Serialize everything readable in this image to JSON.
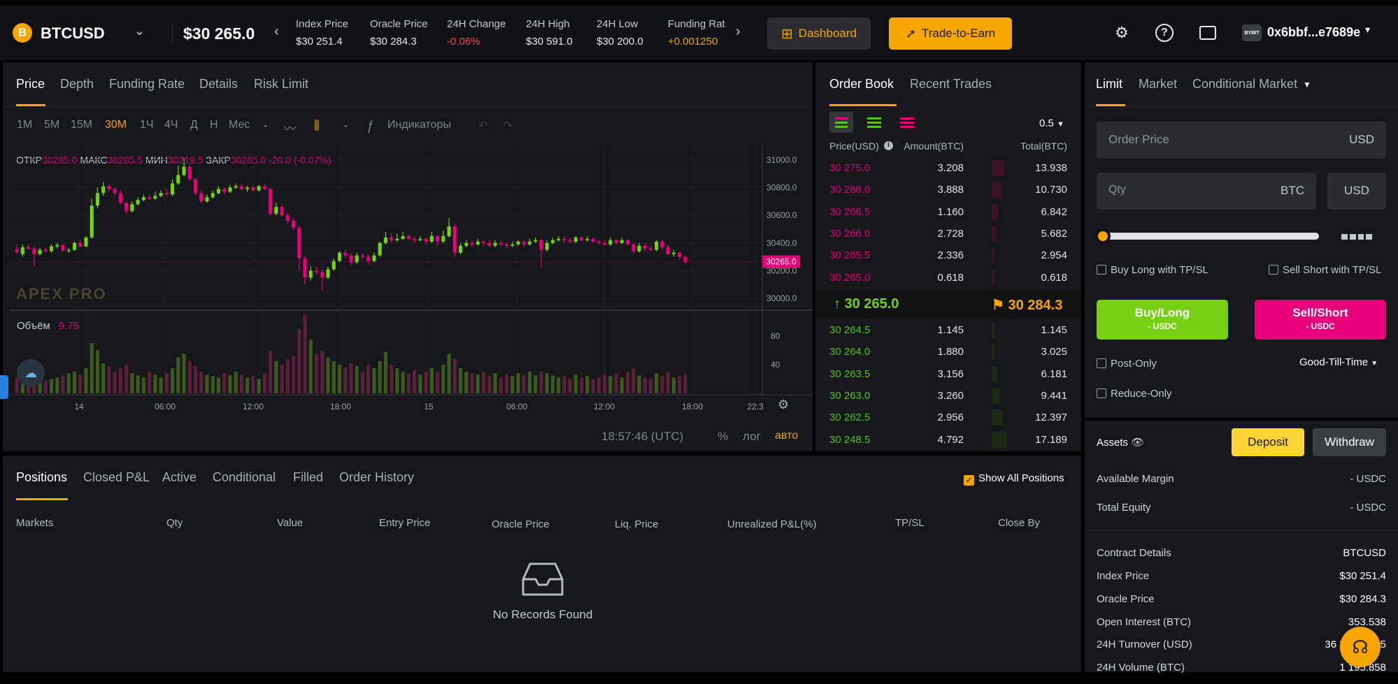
{
  "header": {
    "coin_glyph": "B",
    "symbol": "BTCUSD",
    "last_price": "$30 265.0",
    "stats": [
      {
        "label": "Index Price",
        "value": "$30 251.4",
        "color": "#e6e8ea"
      },
      {
        "label": "Oracle Price",
        "value": "$30 284.3",
        "color": "#e6e8ea"
      },
      {
        "label": "24H Change",
        "value": "-0.06%",
        "color": "#f6465d"
      },
      {
        "label": "24H High",
        "value": "$30 591.0",
        "color": "#e6e8ea"
      },
      {
        "label": "24H Low",
        "value": "$30 200.0",
        "color": "#e6e8ea"
      },
      {
        "label": "Funding Rat",
        "value": "+0.001250",
        "color": "#f7a600"
      }
    ],
    "dashboard_label": "Dashboard",
    "trade_to_earn_label": "Trade-to-Earn",
    "wallet_badge": "BYBIT",
    "wallet_address": "0x6bbf...e7689e"
  },
  "chart_tabs": [
    "Price",
    "Depth",
    "Funding Rate",
    "Details",
    "Risk Limit"
  ],
  "chart_toolbar": {
    "intervals": [
      "1M",
      "5M",
      "15M",
      "30M",
      "1Ч",
      "4Ч",
      "Д",
      "Н",
      "Мес"
    ],
    "active_interval": "30M",
    "indicators_label": "Индикаторы"
  },
  "ohlc": {
    "open_label": "ОТКР",
    "open": "30285.0",
    "high_label": "МАКС",
    "high": "30285.5",
    "low_label": "МИН",
    "low": "30219.5",
    "close_label": "ЗАКР",
    "close": "30265.0",
    "change": "-20.0 (-0.07%)"
  },
  "volume": {
    "label": "Объём",
    "value": "9.75"
  },
  "watermark": "APEX PRO",
  "chart_footer": {
    "time": "18:57:46 (UTC)",
    "pct": "%",
    "log": "лог",
    "auto": "авто"
  },
  "chart_data": {
    "type": "candlestick",
    "y_ticks": [
      31000,
      30800,
      30600,
      30400,
      30200,
      30000
    ],
    "ylim": [
      29935,
      31120
    ],
    "last_price_label": "30265.0",
    "x_ticks": [
      "14",
      "06:00",
      "12:00",
      "18:00",
      "15",
      "06:00",
      "12:00",
      "18:00",
      "22:3"
    ],
    "volume_ticks": [
      80,
      40
    ],
    "volume_max": 110,
    "candles": [
      [
        30355,
        30335,
        30390,
        30320
      ],
      [
        30320,
        30370,
        30390,
        30300
      ],
      [
        30370,
        30360,
        30390,
        30350
      ],
      [
        30360,
        30320,
        30375,
        30230
      ],
      [
        30320,
        30350,
        30365,
        30310
      ],
      [
        30350,
        30340,
        30370,
        30330
      ],
      [
        30340,
        30375,
        30390,
        30330
      ],
      [
        30375,
        30385,
        30400,
        30360
      ],
      [
        30385,
        30345,
        30395,
        30335
      ],
      [
        30345,
        30350,
        30365,
        30330
      ],
      [
        30350,
        30400,
        30410,
        30345
      ],
      [
        30400,
        30375,
        30420,
        30365
      ],
      [
        30375,
        30440,
        30450,
        30370
      ],
      [
        30440,
        30670,
        30720,
        30430
      ],
      [
        30670,
        30760,
        30800,
        30650
      ],
      [
        30760,
        30810,
        30840,
        30740
      ],
      [
        30810,
        30790,
        30830,
        30770
      ],
      [
        30790,
        30760,
        30800,
        30740
      ],
      [
        30760,
        30690,
        30780,
        30680
      ],
      [
        30690,
        30630,
        30700,
        30610
      ],
      [
        30630,
        30680,
        30700,
        30620
      ],
      [
        30680,
        30710,
        30730,
        30670
      ],
      [
        30710,
        30730,
        30750,
        30700
      ],
      [
        30730,
        30720,
        30750,
        30710
      ],
      [
        30720,
        30740,
        30770,
        30710
      ],
      [
        30740,
        30760,
        30780,
        30730
      ],
      [
        30760,
        30750,
        30790,
        30740
      ],
      [
        30750,
        30830,
        30860,
        30740
      ],
      [
        30830,
        30890,
        30960,
        30820
      ],
      [
        30890,
        30950,
        31010,
        30880
      ],
      [
        30950,
        30860,
        30970,
        30850
      ],
      [
        30860,
        30760,
        30870,
        30740
      ],
      [
        30760,
        30700,
        30780,
        30690
      ],
      [
        30700,
        30730,
        30750,
        30690
      ],
      [
        30730,
        30760,
        30780,
        30720
      ],
      [
        30760,
        30790,
        30810,
        30750
      ],
      [
        30790,
        30770,
        30800,
        30750
      ],
      [
        30770,
        30800,
        30820,
        30760
      ],
      [
        30800,
        30810,
        30830,
        30790
      ],
      [
        30810,
        30790,
        30830,
        30780
      ],
      [
        30790,
        30800,
        30810,
        30770
      ],
      [
        30800,
        30780,
        30820,
        30770
      ],
      [
        30780,
        30810,
        30820,
        30770
      ],
      [
        30810,
        30790,
        30830,
        30780
      ],
      [
        30790,
        30610,
        30800,
        30600
      ],
      [
        30610,
        30660,
        30690,
        30600
      ],
      [
        30660,
        30600,
        30680,
        30590
      ],
      [
        30600,
        30560,
        30620,
        30540
      ],
      [
        30560,
        30510,
        30580,
        30490
      ],
      [
        30510,
        30290,
        30530,
        30200
      ],
      [
        30290,
        30150,
        30310,
        30100
      ],
      [
        30150,
        30200,
        30230,
        30130
      ],
      [
        30200,
        30190,
        30230,
        30170
      ],
      [
        30190,
        30150,
        30210,
        30060
      ],
      [
        30150,
        30210,
        30230,
        30140
      ],
      [
        30210,
        30270,
        30290,
        30200
      ],
      [
        30270,
        30330,
        30340,
        30260
      ],
      [
        30330,
        30310,
        30350,
        30290
      ],
      [
        30310,
        30260,
        30330,
        30240
      ],
      [
        30260,
        30310,
        30330,
        30250
      ],
      [
        30310,
        30300,
        30330,
        30280
      ],
      [
        30300,
        30270,
        30320,
        30240
      ],
      [
        30270,
        30310,
        30330,
        30260
      ],
      [
        30310,
        30400,
        30410,
        30300
      ],
      [
        30400,
        30440,
        30480,
        30390
      ],
      [
        30440,
        30420,
        30470,
        30400
      ],
      [
        30420,
        30430,
        30470,
        30410
      ],
      [
        30430,
        30450,
        30480,
        30420
      ],
      [
        30450,
        30430,
        30460,
        30420
      ],
      [
        30430,
        30420,
        30450,
        30400
      ],
      [
        30420,
        30430,
        30450,
        30410
      ],
      [
        30430,
        30410,
        30440,
        30390
      ],
      [
        30410,
        30450,
        30480,
        30400
      ],
      [
        30450,
        30410,
        30460,
        30380
      ],
      [
        30410,
        30450,
        30490,
        30400
      ],
      [
        30450,
        30520,
        30580,
        30440
      ],
      [
        30520,
        30330,
        30540,
        30300
      ],
      [
        30330,
        30380,
        30400,
        30320
      ],
      [
        30380,
        30400,
        30420,
        30370
      ],
      [
        30400,
        30390,
        30420,
        30370
      ],
      [
        30390,
        30410,
        30430,
        30380
      ],
      [
        30410,
        30400,
        30420,
        30380
      ],
      [
        30400,
        30380,
        30420,
        30370
      ],
      [
        30380,
        30400,
        30420,
        30370
      ],
      [
        30400,
        30390,
        30420,
        30380
      ],
      [
        30390,
        30380,
        30410,
        30360
      ],
      [
        30380,
        30390,
        30410,
        30370
      ],
      [
        30390,
        30410,
        30420,
        30380
      ],
      [
        30410,
        30390,
        30420,
        30370
      ],
      [
        30390,
        30410,
        30430,
        30380
      ],
      [
        30410,
        30420,
        30440,
        30400
      ],
      [
        30420,
        30350,
        30430,
        30220
      ],
      [
        30350,
        30400,
        30420,
        30340
      ],
      [
        30400,
        30420,
        30440,
        30390
      ],
      [
        30420,
        30430,
        30450,
        30410
      ],
      [
        30430,
        30420,
        30450,
        30400
      ],
      [
        30420,
        30410,
        30440,
        30400
      ],
      [
        30410,
        30440,
        30450,
        30400
      ],
      [
        30440,
        30420,
        30450,
        30410
      ],
      [
        30420,
        30430,
        30450,
        30410
      ],
      [
        30430,
        30410,
        30440,
        30400
      ],
      [
        30410,
        30400,
        30420,
        30390
      ],
      [
        30400,
        30390,
        30420,
        30380
      ],
      [
        30390,
        30420,
        30440,
        30380
      ],
      [
        30420,
        30400,
        30430,
        30390
      ],
      [
        30400,
        30420,
        30440,
        30390
      ],
      [
        30420,
        30390,
        30430,
        30380
      ],
      [
        30390,
        30340,
        30400,
        30320
      ],
      [
        30340,
        30380,
        30400,
        30330
      ],
      [
        30380,
        30360,
        30400,
        30340
      ],
      [
        30360,
        30350,
        30380,
        30340
      ],
      [
        30350,
        30410,
        30420,
        30340
      ],
      [
        30410,
        30370,
        30420,
        30350
      ],
      [
        30370,
        30320,
        30390,
        30310
      ],
      [
        30320,
        30330,
        30350,
        30300
      ],
      [
        30330,
        30300,
        30340,
        30280
      ],
      [
        30300,
        30265,
        30310,
        30250
      ]
    ],
    "volumes": [
      22,
      18,
      20,
      30,
      25,
      18,
      20,
      22,
      25,
      28,
      30,
      26,
      35,
      70,
      60,
      42,
      38,
      30,
      35,
      40,
      28,
      25,
      22,
      30,
      26,
      22,
      28,
      35,
      50,
      55,
      45,
      38,
      30,
      26,
      24,
      22,
      28,
      25,
      30,
      26,
      22,
      24,
      20,
      28,
      60,
      45,
      40,
      48,
      52,
      90,
      110,
      75,
      55,
      60,
      50,
      45,
      40,
      36,
      42,
      38,
      30,
      40,
      35,
      45,
      58,
      40,
      35,
      30,
      28,
      32,
      26,
      30,
      35,
      30,
      40,
      55,
      48,
      35,
      30,
      28,
      26,
      30,
      24,
      28,
      22,
      26,
      24,
      28,
      26,
      30,
      25,
      30,
      28,
      25,
      22,
      24,
      20,
      26,
      22,
      24,
      20,
      22,
      26,
      24,
      28,
      22,
      30,
      35,
      25,
      22,
      20,
      28,
      24,
      30,
      22,
      24,
      26
    ]
  },
  "orderbook": {
    "tabs": [
      "Order Book",
      "Recent Trades"
    ],
    "precision": "0.5",
    "columns": [
      "Price(USD)",
      "Amount(BTC)",
      "Total(BTC)"
    ],
    "asks": [
      {
        "price": "30 275.0",
        "amount": "3.208",
        "total": "13.938",
        "depth": 0.8
      },
      {
        "price": "30 268.0",
        "amount": "3.888",
        "total": "10.730",
        "depth": 0.62
      },
      {
        "price": "30 266.5",
        "amount": "1.160",
        "total": "6.842",
        "depth": 0.4
      },
      {
        "price": "30 266.0",
        "amount": "2.728",
        "total": "5.682",
        "depth": 0.33
      },
      {
        "price": "30 265.5",
        "amount": "2.336",
        "total": "2.954",
        "depth": 0.17
      },
      {
        "price": "30 265.0",
        "amount": "0.618",
        "total": "0.618",
        "depth": 0.04
      }
    ],
    "mid_last": "30 265.0",
    "mid_oracle": "30 284.3",
    "bids": [
      {
        "price": "30 264.5",
        "amount": "1.145",
        "total": "1.145",
        "depth": 0.07
      },
      {
        "price": "30 264.0",
        "amount": "1.880",
        "total": "3.025",
        "depth": 0.18
      },
      {
        "price": "30 263.5",
        "amount": "3.156",
        "total": "6.181",
        "depth": 0.36
      },
      {
        "price": "30 263.0",
        "amount": "3.260",
        "total": "9.441",
        "depth": 0.55
      },
      {
        "price": "30 262.5",
        "amount": "2.956",
        "total": "12.397",
        "depth": 0.72
      },
      {
        "price": "30 248.5",
        "amount": "4.792",
        "total": "17.189",
        "depth": 1.0
      }
    ]
  },
  "order_form": {
    "tabs": [
      "Limit",
      "Market",
      "Conditional Market"
    ],
    "price_placeholder": "Order Price",
    "price_unit": "USD",
    "qty_placeholder": "Qty",
    "qty_unit_btc": "BTC",
    "qty_unit_usd": "USD",
    "slider_value_pct": 0,
    "buy_tpsl": "Buy Long with TP/SL",
    "sell_tpsl": "Sell Short with TP/SL",
    "buy_label": "Buy/Long",
    "buy_sub": "- USDC",
    "sell_label": "Sell/Short",
    "sell_sub": "- USDC",
    "post_only": "Post-Only",
    "tif": "Good-Till-Time",
    "reduce_only": "Reduce-Only"
  },
  "assets": {
    "label": "Assets",
    "deposit": "Deposit",
    "withdraw": "Withdraw",
    "available_margin_label": "Available Margin",
    "available_margin": "- USDC",
    "total_equity_label": "Total Equity",
    "total_equity": "- USDC"
  },
  "contract": {
    "title": "Contract Details",
    "symbol": "BTCUSD",
    "rows": [
      {
        "label": "Index Price",
        "value": "$30 251.4"
      },
      {
        "label": "Oracle Price",
        "value": "$30 284.3"
      },
      {
        "label": "Open Interest (BTC)",
        "value": "353.538"
      },
      {
        "label": "24H Turnover (USD)",
        "value": "36 337 5__.5"
      },
      {
        "label": "24H Volume (BTC)",
        "value": "1 195.858"
      }
    ]
  },
  "positions": {
    "tabs": [
      "Positions",
      "Closed P&L",
      "Active",
      "Conditional",
      "Filled",
      "Order History"
    ],
    "show_all": "Show All Positions",
    "columns": [
      "Markets",
      "Qty",
      "Value",
      "Entry Price",
      "Oracle Price",
      "Liq. Price",
      "Unrealized P&L(%)",
      "TP/SL",
      "Close By"
    ],
    "empty": "No Records Found"
  },
  "colors": {
    "accent": "#f7a600",
    "up": "#76d116",
    "down": "#e6007a",
    "ask": "#e6007a",
    "bid": "#52c41a"
  }
}
